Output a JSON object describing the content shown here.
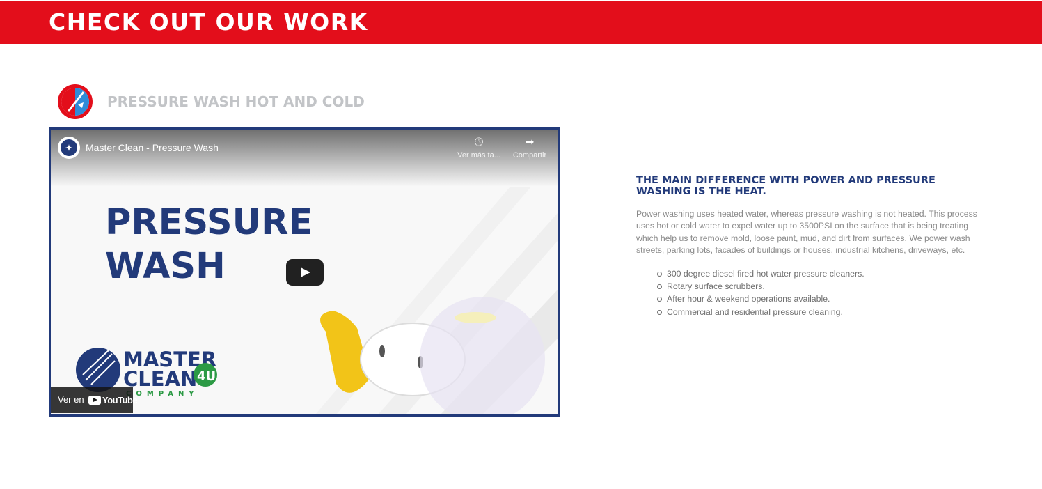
{
  "banner": {
    "title": "CHECK OUT OUR WORK",
    "color": "#e30e1b"
  },
  "service": {
    "logo_icon": "pressure-wash-logo-icon",
    "title": "PRESSURE WASH HOT AND COLD"
  },
  "video": {
    "channel_icon": "channel-avatar-icon",
    "title": "Master Clean - Pressure Wash",
    "watch_later_label": "Ver más ta...",
    "share_label": "Compartir",
    "thumbnail_line1": "PRESSURE",
    "thumbnail_line2": "WASH",
    "brand_line1": "MASTER",
    "brand_line2": "CLEAN",
    "brand_badge": "4U",
    "brand_sub": "COMPANY",
    "watch_on_label": "Ver en",
    "youtube_word": "YouTube",
    "border_color": "#223a7a"
  },
  "description": {
    "heading": "THE MAIN DIFFERENCE WITH POWER AND PRESSURE WASHING IS THE HEAT.",
    "body": "Power washing uses heated water, whereas pressure washing is not heated. This process uses hot or cold water to expel water up to 3500PSI on the surface that is being treating which help us to remove mold, loose paint, mud, and dirt from surfaces. We power wash streets, parking lots, facades of buildings or houses, industrial kitchens, driveways, etc.",
    "items": [
      "300 degree diesel fired hot water pressure cleaners.",
      "Rotary surface scrubbers.",
      "After hour & weekend operations available.",
      "Commercial and residential pressure cleaning."
    ]
  }
}
